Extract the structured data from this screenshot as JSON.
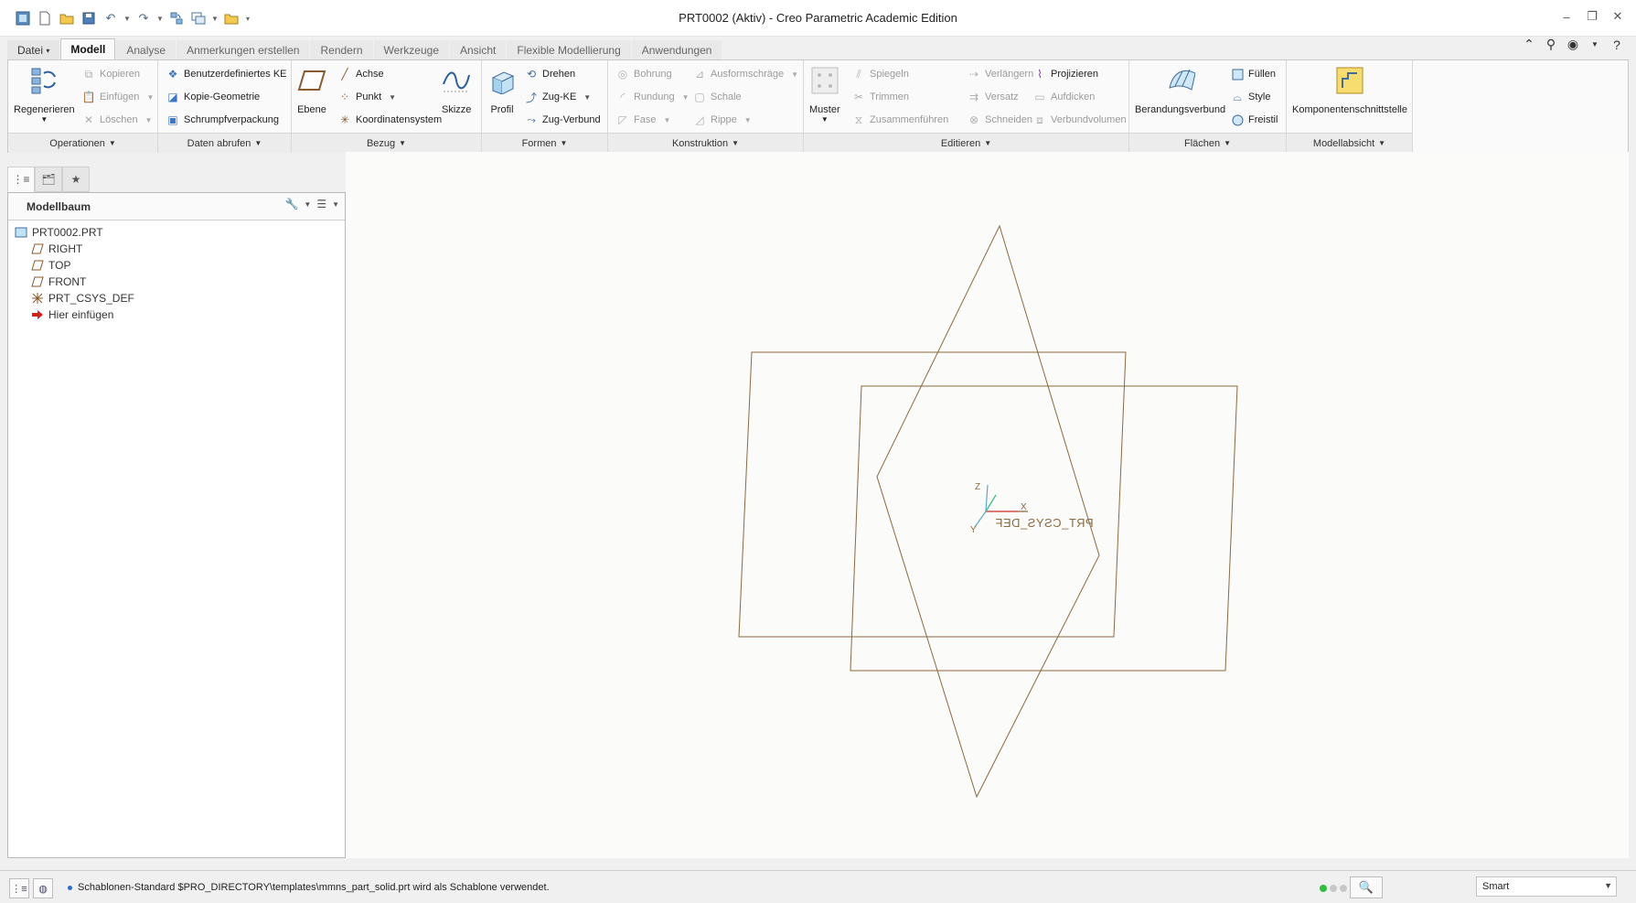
{
  "window": {
    "title": "PRT0002 (Aktiv) - Creo Parametric Academic Edition",
    "controls": [
      "minimize-icon",
      "restore-icon",
      "close-icon"
    ]
  },
  "quick_access": [
    "new-icon",
    "open-icon",
    "save-icon",
    "undo-icon",
    "redo-icon",
    "regenerate-icon",
    "windows-icon",
    "close-window-icon",
    "customize-icon"
  ],
  "tabs": [
    {
      "label": "Datei",
      "file": true
    },
    {
      "label": "Modell",
      "active": true
    },
    {
      "label": "Analyse"
    },
    {
      "label": "Anmerkungen erstellen"
    },
    {
      "label": "Rendern"
    },
    {
      "label": "Werkzeuge"
    },
    {
      "label": "Ansicht"
    },
    {
      "label": "Flexible Modellierung"
    },
    {
      "label": "Anwendungen"
    }
  ],
  "ribbon": {
    "operationen": {
      "footer": "Operationen",
      "regenerieren": "Regenerieren",
      "kopieren": "Kopieren",
      "einfuegen": "Einfügen",
      "loeschen": "Löschen"
    },
    "daten": {
      "footer": "Daten abrufen",
      "benutzer": "Benutzerdefiniertes KE",
      "kopie": "Kopie-Geometrie",
      "schrumpf": "Schrumpfverpackung"
    },
    "bezug": {
      "footer": "Bezug",
      "ebene": "Ebene",
      "achse": "Achse",
      "punkt": "Punkt",
      "koordinatensystem": "Koordinatensystem",
      "skizze": "Skizze"
    },
    "formen": {
      "footer": "Formen",
      "profil": "Profil",
      "drehen": "Drehen",
      "zug_ke": "Zug-KE",
      "zug_verbund": "Zug-Verbund"
    },
    "konstruktion": {
      "footer": "Konstruktion",
      "bohrung": "Bohrung",
      "rundung": "Rundung",
      "fase": "Fase",
      "ausformschraege": "Ausformschräge",
      "schale": "Schale",
      "rippe": "Rippe"
    },
    "editieren": {
      "footer": "Editieren",
      "muster": "Muster",
      "spiegeln": "Spiegeln",
      "trimmen": "Trimmen",
      "zusammenfuehren": "Zusammenführen",
      "verlaengern": "Verlängern",
      "versatz": "Versatz",
      "schneiden": "Schneiden",
      "projizieren": "Projizieren",
      "aufdicken": "Aufdicken",
      "verbundvolumen": "Verbundvolumen"
    },
    "flaechen": {
      "footer": "Flächen",
      "berandungsverbund": "Berandungsverbund",
      "fuellen": "Füllen",
      "style": "Style",
      "freistil": "Freistil"
    },
    "modellabsicht": {
      "footer": "Modellabsicht",
      "komponenten": "Komponentenschnittstelle"
    }
  },
  "view_toolbar": [
    "refit-icon",
    "zoom-in-icon",
    "zoom-out-icon",
    "repaint-icon",
    "display-style-icon",
    "saved-orientations-icon",
    "view-manager-icon",
    "perspective-icon",
    "datum-display-icon",
    "annotation-display-icon",
    "spin-center-icon"
  ],
  "model_tree": {
    "header": "Modellbaum",
    "items": [
      {
        "label": "PRT0002.PRT",
        "icon": "part-icon",
        "level": 0
      },
      {
        "label": "RIGHT",
        "icon": "datum-plane-icon",
        "level": 1
      },
      {
        "label": "TOP",
        "icon": "datum-plane-icon",
        "level": 1
      },
      {
        "label": "FRONT",
        "icon": "datum-plane-icon",
        "level": 1
      },
      {
        "label": "PRT_CSYS_DEF",
        "icon": "csys-icon",
        "level": 1
      },
      {
        "label": "Hier einfügen",
        "icon": "insert-here-icon",
        "level": 1
      }
    ]
  },
  "graphics": {
    "csys_label": "PRT_CSYS_DEF",
    "axis_x": "X",
    "axis_y": "Y",
    "axis_z": "Z",
    "datum_color": "#8a6a3f"
  },
  "status": {
    "message": "Schablonen-Standard $PRO_DIRECTORY\\templates\\mmns_part_solid.prt wird als Schablone verwendet.",
    "filter": "Smart"
  }
}
